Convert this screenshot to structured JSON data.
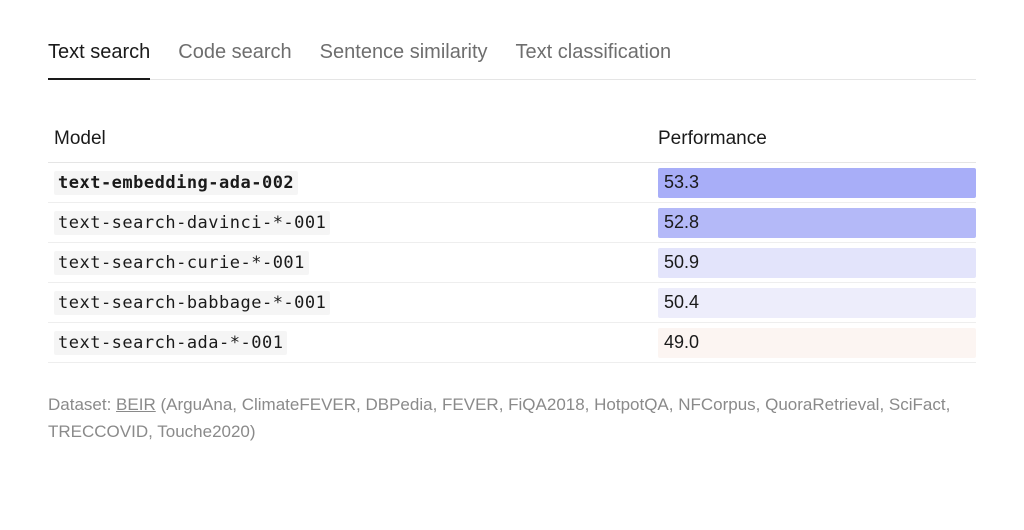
{
  "tabs": [
    {
      "label": "Text search",
      "active": true
    },
    {
      "label": "Code search",
      "active": false
    },
    {
      "label": "Sentence similarity",
      "active": false
    },
    {
      "label": "Text classification",
      "active": false
    }
  ],
  "table": {
    "headers": {
      "model": "Model",
      "performance": "Performance"
    },
    "rows": [
      {
        "model": "text-embedding-ada-002",
        "bold": true,
        "value": "53.3",
        "bar_pct": 100,
        "bar_color": "#a8aef8"
      },
      {
        "model": "text-search-davinci-*-001",
        "bold": false,
        "value": "52.8",
        "bar_pct": 100,
        "bar_color": "#b4b9f8"
      },
      {
        "model": "text-search-curie-*-001",
        "bold": false,
        "value": "50.9",
        "bar_pct": 100,
        "bar_color": "#e3e4fb"
      },
      {
        "model": "text-search-babbage-*-001",
        "bold": false,
        "value": "50.4",
        "bar_pct": 100,
        "bar_color": "#ededfb"
      },
      {
        "model": "text-search-ada-*-001",
        "bold": false,
        "value": "49.0",
        "bar_pct": 100,
        "bar_color": "#fcf5f2"
      }
    ]
  },
  "footnote": {
    "prefix": "Dataset: ",
    "dataset": "BEIR",
    "suffix": " (ArguAna, ClimateFEVER, DBPedia, FEVER, FiQA2018, HotpotQA, NFCorpus, QuoraRetrieval, SciFact, TRECCOVID, Touche2020)"
  },
  "chart_data": {
    "type": "bar",
    "title": "Text search",
    "categories": [
      "text-embedding-ada-002",
      "text-search-davinci-*-001",
      "text-search-curie-*-001",
      "text-search-babbage-*-001",
      "text-search-ada-*-001"
    ],
    "values": [
      53.3,
      52.8,
      50.9,
      50.4,
      49.0
    ],
    "xlabel": "Performance",
    "ylabel": "Model",
    "ylim": [
      49.0,
      53.3
    ],
    "dataset": "BEIR (ArguAna, ClimateFEVER, DBPedia, FEVER, FiQA2018, HotpotQA, NFCorpus, QuoraRetrieval, SciFact, TRECCOVID, Touche2020)"
  }
}
